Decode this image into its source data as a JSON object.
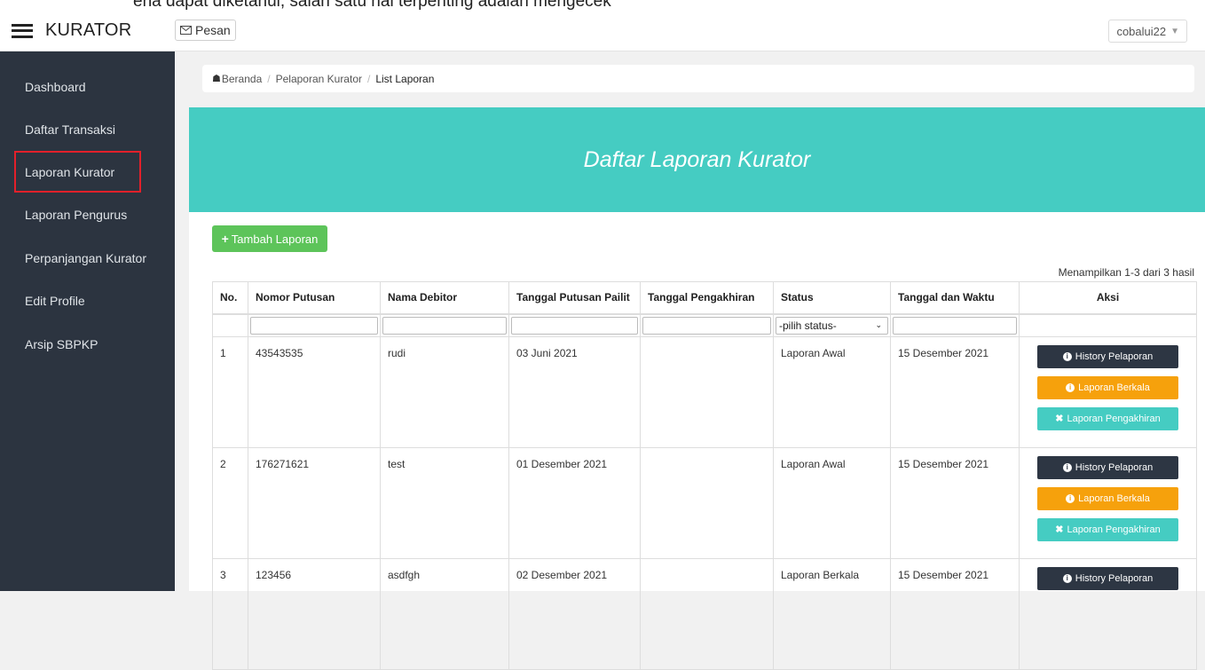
{
  "header": {
    "cutoff_text": "ena dapat diketahui, salah satu hal terpenting adalah mengecek",
    "brand": "KURATOR",
    "pesan_label": "Pesan",
    "user": "cobalui22"
  },
  "sidebar": {
    "items": [
      {
        "label": "Dashboard"
      },
      {
        "label": "Daftar Transaksi"
      },
      {
        "label": "Laporan Kurator"
      },
      {
        "label": "Laporan Pengurus"
      },
      {
        "label": "Perpanjangan Kurator"
      },
      {
        "label": "Edit Profile"
      },
      {
        "label": "Arsip SBPKP"
      }
    ],
    "active": "Laporan Kurator"
  },
  "breadcrumb": {
    "home": "Beranda",
    "parent": "Pelaporan Kurator",
    "current": "List Laporan"
  },
  "panel": {
    "title": "Daftar Laporan Kurator",
    "add_button": "Tambah Laporan",
    "result_info": "Menampilkan 1-3 dari 3 hasil"
  },
  "table": {
    "headers": [
      "No.",
      "Nomor Putusan",
      "Nama Debitor",
      "Tanggal Putusan Pailit",
      "Tanggal Pengakhiran",
      "Status",
      "Tanggal dan Waktu",
      "Aksi"
    ],
    "status_filter": "-pilih status-",
    "rows": [
      {
        "no": "1",
        "nomor": "43543535",
        "debitor": "rudi",
        "tgl_putusan": "03 Juni 2021",
        "tgl_akhir": "",
        "status": "Laporan Awal",
        "tgl_waktu": "15 Desember 2021"
      },
      {
        "no": "2",
        "nomor": "176271621",
        "debitor": "test",
        "tgl_putusan": "01 Desember 2021",
        "tgl_akhir": "",
        "status": "Laporan Awal",
        "tgl_waktu": "15 Desember 2021"
      },
      {
        "no": "3",
        "nomor": "123456",
        "debitor": "asdfgh",
        "tgl_putusan": "02 Desember 2021",
        "tgl_akhir": "",
        "status": "Laporan Berkala",
        "tgl_waktu": "15 Desember 2021"
      }
    ],
    "actions": {
      "history": "History Pelaporan",
      "berkala": "Laporan Berkala",
      "pengakhiran": "Laporan Pengakhiran"
    }
  }
}
